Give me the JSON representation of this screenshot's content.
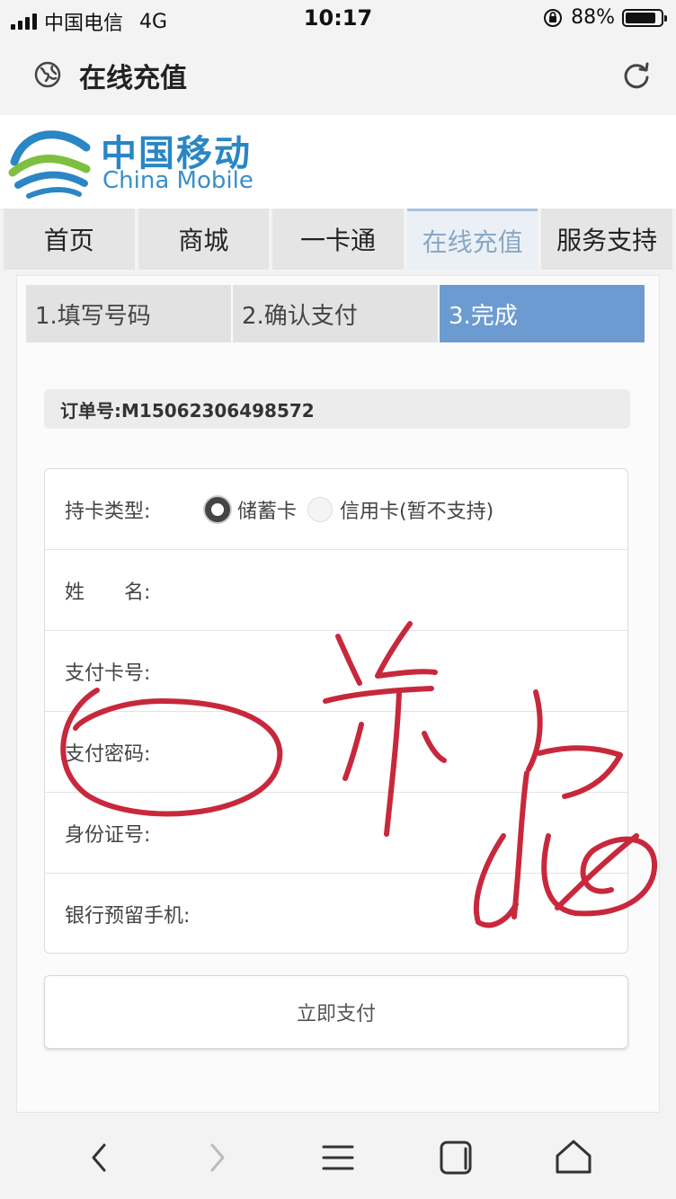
{
  "status_bar": {
    "carrier": "中国电信",
    "network": "4G",
    "time": "10:17",
    "battery_percent": "88%",
    "battery_level": 0.88
  },
  "browser": {
    "title": "在线充值",
    "globe_icon": "globe-icon",
    "reload_icon": "reload-icon"
  },
  "logo": {
    "cn": "中国移动",
    "en": "China Mobile",
    "color": "#2a86c4"
  },
  "nav": {
    "tabs": [
      {
        "label": "首页"
      },
      {
        "label": "商城"
      },
      {
        "label": "一卡通"
      },
      {
        "label": "在线充值"
      },
      {
        "label": "服务支持"
      }
    ],
    "active_index": 3
  },
  "steps": {
    "items": [
      {
        "label": "1.填写号码"
      },
      {
        "label": "2.确认支付"
      },
      {
        "label": "3.完成"
      }
    ],
    "active_index": 2,
    "active_color": "#6c9bd2"
  },
  "order": {
    "label": "订单号:M15062306498572"
  },
  "form": {
    "card_type_label": "持卡类型:",
    "debit_label": "储蓄卡",
    "credit_label": "信用卡(暂不支持)",
    "name_label": "姓　　名:",
    "card_number_label": "支付卡号:",
    "password_label": "支付密码:",
    "id_label": "身份证号:",
    "phone_label": "银行预留手机:"
  },
  "pay_button": {
    "label": "立即支付"
  },
  "annotation_color": "#c8283c",
  "toolbar_icons": [
    "back-icon",
    "forward-icon",
    "menu-icon",
    "tabs-icon",
    "home-icon"
  ]
}
